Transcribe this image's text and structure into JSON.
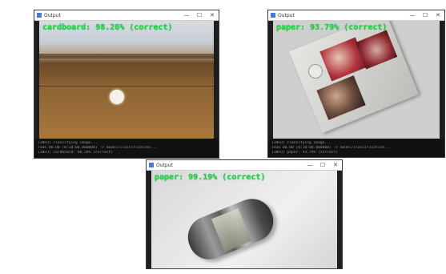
{
  "windows": [
    {
      "title": "Output",
      "overlay": "cardboard: 98.26% (correct)",
      "console": [
        "[INFO] classifying image...",
        "Took 00.00 (0:10:00.000000) -> model/classification...",
        "[INFO] cardboard: 98.26% (correct)"
      ]
    },
    {
      "title": "Output",
      "overlay": "paper: 93.79% (correct)",
      "console": [
        "[INFO] classifying image...",
        "Took 00.00 (0:10:00.000000) -> model/classification...",
        "[INFO] paper: 93.79% (correct)"
      ]
    },
    {
      "title": "Output",
      "overlay": "paper: 99.19% (correct)",
      "console": []
    }
  ],
  "window_controls": {
    "minimize": "—",
    "maximize": "☐",
    "close": "✕"
  }
}
